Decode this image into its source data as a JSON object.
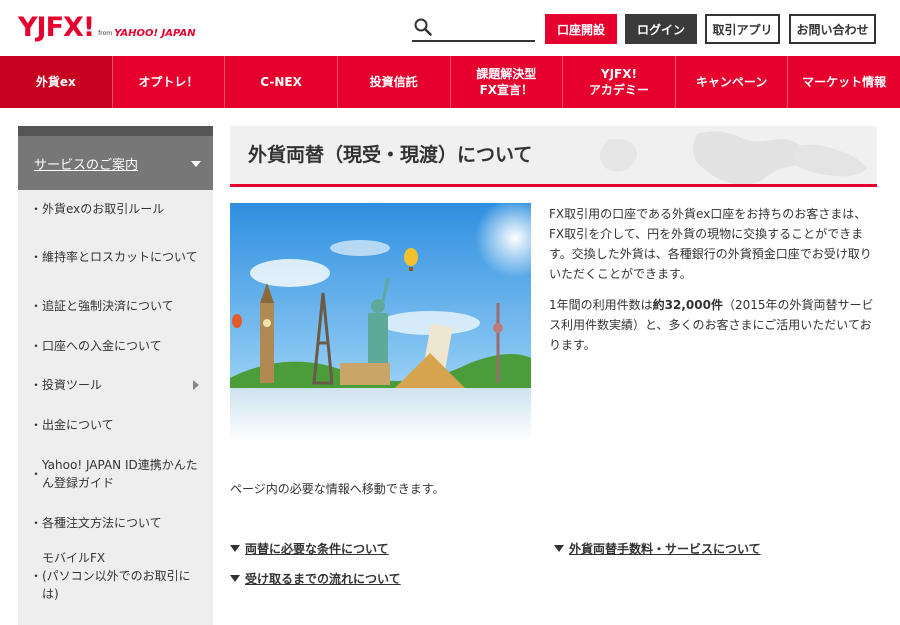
{
  "header": {
    "logo_text": "YJFX!",
    "logo_from": "from",
    "logo_yahoo": "YAHOO! JAPAN",
    "search_placeholder": "",
    "account_open_button": "口座開設",
    "login_button": "ログイン",
    "trading_app_button": "取引アプリ",
    "contact_button": "お問い合わせ"
  },
  "nav": {
    "items": [
      {
        "label": "外貨ex",
        "active": true
      },
      {
        "label": "オプトレ！"
      },
      {
        "label": "C-NEX"
      },
      {
        "label": "投資信託"
      },
      {
        "label": "課題解決型\nFX宣言！"
      },
      {
        "label": "YJFX!\nアカデミー"
      },
      {
        "label": "キャンペーン"
      },
      {
        "label": "マーケット情報"
      }
    ]
  },
  "sidebar": {
    "header": "サービスのご案内",
    "items": [
      {
        "label": "外貨exのお取引ルール"
      },
      {
        "label": "維持率とロスカットについて"
      },
      {
        "label": "追証と強制決済について"
      },
      {
        "label": "口座への入金について"
      },
      {
        "label": "投資ツール"
      },
      {
        "label": "出金について"
      },
      {
        "label": "Yahoo! JAPAN ID連携かんたん登録ガイド"
      },
      {
        "label": "各種注文方法について"
      },
      {
        "label": "モバイルFX\n(パソコン以外でのお取引には)"
      }
    ]
  },
  "main": {
    "title": "外貨両替（現受・現渡）について",
    "intro_p1": "FX取引用の口座である外貨ex口座をお持ちのお客さまは、FX取引を介して、円を外貨の現物に交換することができます。交換した外貨は、各種銀行の外貨預金口座でお受け取りいただくことができます。",
    "intro_p2_before": "1年間の利用件数は",
    "intro_p2_bold": "約32,000件",
    "intro_p2_after": "（2015年の外貨両替サービス利用件数実績）と、多くのお客さまにご活用いただいております。",
    "move_text": "ページ内の必要な情報へ移動できます。",
    "link_conditions": "両替に必要な条件について",
    "link_fees": "外貨両替手数料・サービスについて",
    "link_flow": "受け取るまでの流れについて"
  },
  "colors": {
    "brand_red": "#e6002d",
    "dark_button": "#3a3a3a",
    "sidebar_bg": "#eeeeee",
    "sidebar_header_bg": "#777777"
  }
}
